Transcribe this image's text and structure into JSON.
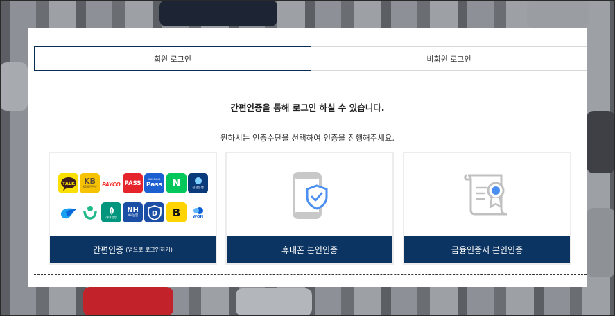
{
  "tabs": {
    "member": "회원 로그인",
    "guest": "비회원 로그인"
  },
  "headline": "간편인증을 통해 로그인 하실 수 있습니다.",
  "subline": "원하시는 인증수단을 선택하여 인증을 진행해주세요.",
  "cards": {
    "simple": {
      "label": "간편인증",
      "note": "(앱으로 로그인하기)"
    },
    "phone": {
      "label": "휴대폰 본인인증"
    },
    "cert": {
      "label": "금융인증서 본인인증"
    }
  },
  "logos": {
    "kakao": "TALK",
    "kb": "KB",
    "payco": "PAYCO",
    "pass_red": "PASS",
    "samsung_pass": "Pass",
    "samsung_small": "SAMSUNG",
    "naver": "N",
    "shinhan": "신한은행",
    "hana_en": "하나은행",
    "nh": "NH",
    "nh_small": "NH농협",
    "won": "WON",
    "kb_small": "KB국민은행"
  },
  "colors": {
    "navy": "#0c3462",
    "tab_border": "#0c2d52",
    "kakao": "#f9e000",
    "payco": "#f3352e",
    "pass": "#e5242c",
    "samsung": "#1c5fd1",
    "naver": "#03c75a",
    "shinhan": "#0046ff",
    "hana": "#00957d",
    "nh": "#1b4fa6",
    "toss": "#0071e3"
  }
}
